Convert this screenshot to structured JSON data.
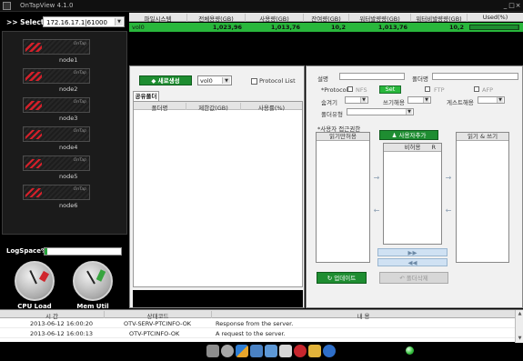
{
  "window": {
    "title": "OnTapView 4.1.0",
    "minimize": "_",
    "maximize": "□",
    "close": "×"
  },
  "server_select": {
    "label": ">> Select",
    "value": "172.16.17.1|61000"
  },
  "nodes": [
    {
      "label": "node1",
      "brand": "OnTap"
    },
    {
      "label": "node2",
      "brand": "OnTap"
    },
    {
      "label": "node3",
      "brand": "OnTap"
    },
    {
      "label": "node4",
      "brand": "OnTap"
    },
    {
      "label": "node5",
      "brand": "OnTap"
    },
    {
      "label": "node6",
      "brand": "OnTap"
    }
  ],
  "logspace": {
    "label": "LogSpace%",
    "fraction": 0.04,
    "color": "#28a43c"
  },
  "gauges": {
    "cpu_label": "CPU Load",
    "mem_label": "Mem Util"
  },
  "volume_table": {
    "headers": [
      "파일시스템",
      "전체용량(GB)",
      "사용량(GB)",
      "잔여량(GB)",
      "워터발량량(GB)",
      "워터비발량량(GB)",
      "Used(%)"
    ],
    "row": {
      "name": "vol0",
      "total": "1,023,96",
      "used": "1,013,76",
      "free": "10,2",
      "w1": "1,013,76",
      "w2": "10,2",
      "used_fraction": 0.99
    }
  },
  "create_panel": {
    "new_button": "새로생성",
    "volume_select": "vol0",
    "protocol_list_label": "Protocol List",
    "tab_label": "공유폴더",
    "headers": [
      "폴더명",
      "제한값(GB)",
      "사용률(%)"
    ]
  },
  "detail": {
    "desc_label": "설명",
    "folder_name_label": "폴더명",
    "protocol_label": "*Protocol :",
    "nfs": "NFS",
    "set_button": "Set",
    "ftp": "FTP",
    "afp": "AFP",
    "hide_label": "숨겨기",
    "write_label": "쓰기해용",
    "guest_label": "게스트해용",
    "folder_type_label": "폴더유형",
    "acl_label": "*사용자 접근권한",
    "read_only_title": "읽기만허용",
    "add_user_button": "사용자추가",
    "deny_col": "비허용",
    "r_col": "R",
    "read_write_title": "읽기 & 쓰기",
    "update_button": "업데이트",
    "delete_button": "폴더삭제",
    "right_arrow": "→",
    "left_arrow": "←",
    "dbl_right": "▶▶",
    "dbl_left": "◀◀"
  },
  "log": {
    "headers": [
      "시  간",
      "상태코드",
      "내  용"
    ],
    "rows": [
      {
        "time": "2013-06-12 16:00:20",
        "code": "OTV-SERV-PTCINFO-OK",
        "msg": "Response from the server."
      },
      {
        "time": "2013-06-12 16:00:13",
        "code": "OTV-PTCINFO-OK",
        "msg": "A request to the server."
      }
    ]
  },
  "toolbar_icons": [
    "config-icon",
    "gear-icon",
    "arrows-icon",
    "monitor-icon",
    "network-icon",
    "printer-icon",
    "power-icon",
    "alert-icon",
    "info-icon"
  ]
}
